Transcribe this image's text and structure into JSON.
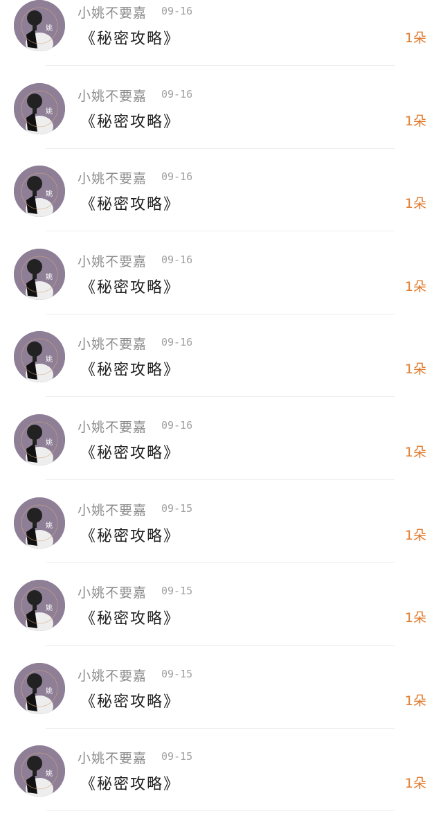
{
  "items": [
    {
      "username": "小姚不要嘉",
      "date": "09-16",
      "title": "《秘密攻略》",
      "count": "1朵"
    },
    {
      "username": "小姚不要嘉",
      "date": "09-16",
      "title": "《秘密攻略》",
      "count": "1朵"
    },
    {
      "username": "小姚不要嘉",
      "date": "09-16",
      "title": "《秘密攻略》",
      "count": "1朵"
    },
    {
      "username": "小姚不要嘉",
      "date": "09-16",
      "title": "《秘密攻略》",
      "count": "1朵"
    },
    {
      "username": "小姚不要嘉",
      "date": "09-16",
      "title": "《秘密攻略》",
      "count": "1朵"
    },
    {
      "username": "小姚不要嘉",
      "date": "09-16",
      "title": "《秘密攻略》",
      "count": "1朵"
    },
    {
      "username": "小姚不要嘉",
      "date": "09-15",
      "title": "《秘密攻略》",
      "count": "1朵"
    },
    {
      "username": "小姚不要嘉",
      "date": "09-15",
      "title": "《秘密攻略》",
      "count": "1朵"
    },
    {
      "username": "小姚不要嘉",
      "date": "09-15",
      "title": "《秘密攻略》",
      "count": "1朵"
    },
    {
      "username": "小姚不要嘉",
      "date": "09-15",
      "title": "《秘密攻略》",
      "count": "1朵"
    }
  ],
  "colors": {
    "accent": "#e07a2e",
    "username": "#8c8c8c",
    "avatar_bg": "#8e7f96"
  }
}
